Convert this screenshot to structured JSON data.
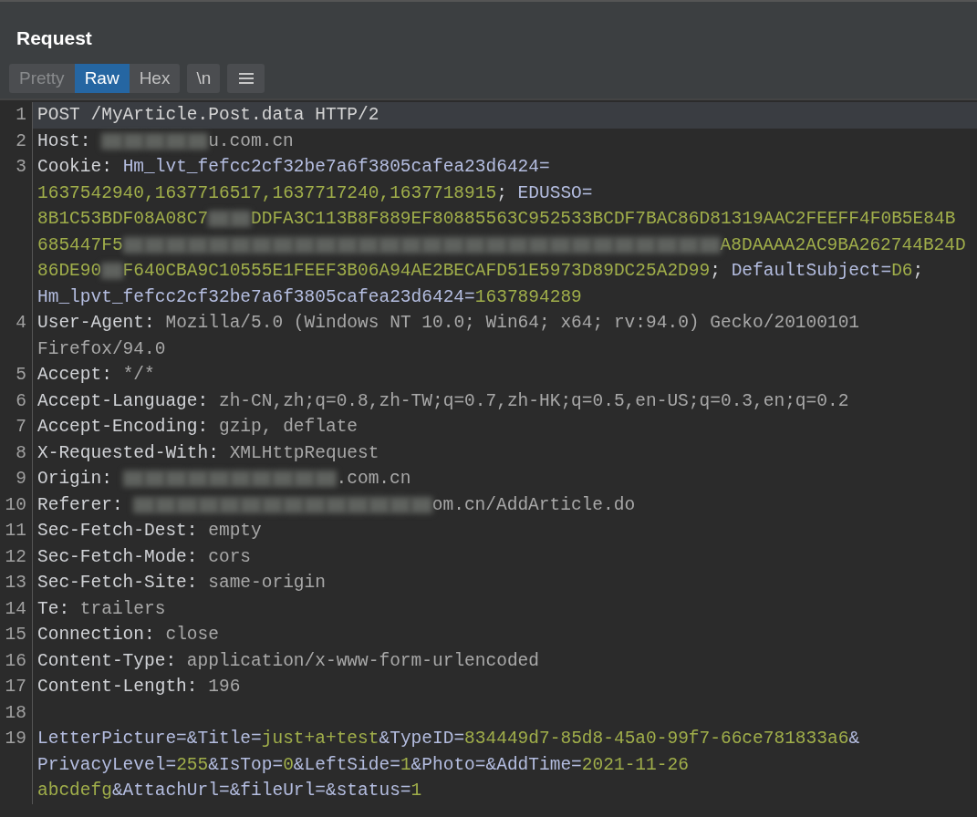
{
  "panel": {
    "title": "Request"
  },
  "tabs": [
    {
      "label": "Pretty",
      "selected": false,
      "disabled": true
    },
    {
      "label": "Raw",
      "selected": true,
      "disabled": false
    },
    {
      "label": "Hex",
      "selected": false,
      "disabled": false
    }
  ],
  "toggle_button": {
    "label": "\\n"
  },
  "editor": {
    "lines": [
      {
        "number": "1",
        "current": true,
        "rows": [
          {
            "segments": [
              {
                "kind": "plain",
                "text": "POST /MyArticle.Post.data HTTP/2"
              }
            ]
          }
        ]
      },
      {
        "number": "2",
        "current": false,
        "rows": [
          {
            "segments": [
              {
                "kind": "name",
                "text": "Host: "
              },
              {
                "kind": "redacted"
              },
              {
                "kind": "redacted"
              },
              {
                "kind": "redacted"
              },
              {
                "kind": "redacted"
              },
              {
                "kind": "redacted"
              },
              {
                "kind": "value",
                "text": "u.com.cn"
              }
            ]
          }
        ]
      },
      {
        "number": "3",
        "current": false,
        "rows": [
          {
            "segments": [
              {
                "kind": "name",
                "text": "Cookie: "
              },
              {
                "kind": "key",
                "text": "Hm_lvt_fefcc2cf32be7a6f3805cafea23d6424="
              }
            ]
          },
          {
            "segments": [
              {
                "kind": "val",
                "text": "1637542940,1637716517,1637717240,1637718915"
              },
              {
                "kind": "name",
                "text": "; "
              },
              {
                "kind": "key",
                "text": "EDUSSO="
              }
            ]
          },
          {
            "segments": [
              {
                "kind": "val",
                "text": "8B1C53BDF08A08C7"
              },
              {
                "kind": "redacted"
              },
              {
                "kind": "redacted"
              },
              {
                "kind": "val",
                "text": "DDFA3C113B8F889EF80885563C952533BCDF7BAC86D81319AAC2FEEFF4F0B5E84B"
              }
            ]
          },
          {
            "segments": [
              {
                "kind": "val",
                "text": "685447F5"
              },
              {
                "kind": "redacted"
              },
              {
                "kind": "redacted"
              },
              {
                "kind": "redacted"
              },
              {
                "kind": "redacted"
              },
              {
                "kind": "redacted"
              },
              {
                "kind": "redacted"
              },
              {
                "kind": "redacted"
              },
              {
                "kind": "redacted"
              },
              {
                "kind": "redacted"
              },
              {
                "kind": "redacted"
              },
              {
                "kind": "redacted"
              },
              {
                "kind": "redacted"
              },
              {
                "kind": "redacted"
              },
              {
                "kind": "redacted"
              },
              {
                "kind": "redacted"
              },
              {
                "kind": "redacted"
              },
              {
                "kind": "redacted"
              },
              {
                "kind": "redacted"
              },
              {
                "kind": "redacted"
              },
              {
                "kind": "redacted"
              },
              {
                "kind": "redacted"
              },
              {
                "kind": "redacted"
              },
              {
                "kind": "redacted"
              },
              {
                "kind": "redacted"
              },
              {
                "kind": "redacted"
              },
              {
                "kind": "redacted"
              },
              {
                "kind": "redacted"
              },
              {
                "kind": "redacted"
              },
              {
                "kind": "val",
                "text": "A8DAAAA2AC9BA262744B24D"
              }
            ]
          },
          {
            "segments": [
              {
                "kind": "val",
                "text": "86DE90"
              },
              {
                "kind": "redacted"
              },
              {
                "kind": "val",
                "text": "F640CBA9C10555E1FEEF3B06A94AE2BECAFD51E5973D89DC25A2D99"
              },
              {
                "kind": "name",
                "text": "; "
              },
              {
                "kind": "key",
                "text": "DefaultSubject="
              },
              {
                "kind": "val",
                "text": "D6"
              },
              {
                "kind": "name",
                "text": ";"
              }
            ]
          },
          {
            "segments": [
              {
                "kind": "key",
                "text": "Hm_lpvt_fefcc2cf32be7a6f3805cafea23d6424="
              },
              {
                "kind": "val",
                "text": "1637894289"
              }
            ]
          }
        ]
      },
      {
        "number": "4",
        "current": false,
        "rows": [
          {
            "segments": [
              {
                "kind": "name",
                "text": "User-Agent: "
              },
              {
                "kind": "value",
                "text": "Mozilla/5.0 (Windows NT 10.0; Win64; x64; rv:94.0) Gecko/20100101"
              }
            ]
          },
          {
            "segments": [
              {
                "kind": "value",
                "text": "Firefox/94.0"
              }
            ]
          }
        ]
      },
      {
        "number": "5",
        "current": false,
        "rows": [
          {
            "segments": [
              {
                "kind": "name",
                "text": "Accept: "
              },
              {
                "kind": "value",
                "text": "*/*"
              }
            ]
          }
        ]
      },
      {
        "number": "6",
        "current": false,
        "rows": [
          {
            "segments": [
              {
                "kind": "name",
                "text": "Accept-Language: "
              },
              {
                "kind": "value",
                "text": "zh-CN,zh;q=0.8,zh-TW;q=0.7,zh-HK;q=0.5,en-US;q=0.3,en;q=0.2"
              }
            ]
          }
        ]
      },
      {
        "number": "7",
        "current": false,
        "rows": [
          {
            "segments": [
              {
                "kind": "name",
                "text": "Accept-Encoding: "
              },
              {
                "kind": "value",
                "text": "gzip, deflate"
              }
            ]
          }
        ]
      },
      {
        "number": "8",
        "current": false,
        "rows": [
          {
            "segments": [
              {
                "kind": "name",
                "text": "X-Requested-With: "
              },
              {
                "kind": "value",
                "text": "XMLHttpRequest"
              }
            ]
          }
        ]
      },
      {
        "number": "9",
        "current": false,
        "rows": [
          {
            "segments": [
              {
                "kind": "name",
                "text": "Origin: "
              },
              {
                "kind": "redacted"
              },
              {
                "kind": "redacted"
              },
              {
                "kind": "redacted"
              },
              {
                "kind": "redacted"
              },
              {
                "kind": "redacted"
              },
              {
                "kind": "redacted"
              },
              {
                "kind": "redacted"
              },
              {
                "kind": "redacted"
              },
              {
                "kind": "redacted"
              },
              {
                "kind": "redacted"
              },
              {
                "kind": "value",
                "text": ".com.cn"
              }
            ]
          }
        ]
      },
      {
        "number": "10",
        "current": false,
        "rows": [
          {
            "segments": [
              {
                "kind": "name",
                "text": "Referer: "
              },
              {
                "kind": "redacted"
              },
              {
                "kind": "redacted"
              },
              {
                "kind": "redacted"
              },
              {
                "kind": "redacted"
              },
              {
                "kind": "redacted"
              },
              {
                "kind": "redacted"
              },
              {
                "kind": "redacted"
              },
              {
                "kind": "redacted"
              },
              {
                "kind": "redacted"
              },
              {
                "kind": "redacted"
              },
              {
                "kind": "redacted"
              },
              {
                "kind": "redacted"
              },
              {
                "kind": "redacted"
              },
              {
                "kind": "redacted"
              },
              {
                "kind": "value",
                "text": "om.cn/AddArticle.do"
              }
            ]
          }
        ]
      },
      {
        "number": "11",
        "current": false,
        "rows": [
          {
            "segments": [
              {
                "kind": "name",
                "text": "Sec-Fetch-Dest: "
              },
              {
                "kind": "value",
                "text": "empty"
              }
            ]
          }
        ]
      },
      {
        "number": "12",
        "current": false,
        "rows": [
          {
            "segments": [
              {
                "kind": "name",
                "text": "Sec-Fetch-Mode: "
              },
              {
                "kind": "value",
                "text": "cors"
              }
            ]
          }
        ]
      },
      {
        "number": "13",
        "current": false,
        "rows": [
          {
            "segments": [
              {
                "kind": "name",
                "text": "Sec-Fetch-Site: "
              },
              {
                "kind": "value",
                "text": "same-origin"
              }
            ]
          }
        ]
      },
      {
        "number": "14",
        "current": false,
        "rows": [
          {
            "segments": [
              {
                "kind": "name",
                "text": "Te: "
              },
              {
                "kind": "value",
                "text": "trailers"
              }
            ]
          }
        ]
      },
      {
        "number": "15",
        "current": false,
        "rows": [
          {
            "segments": [
              {
                "kind": "name",
                "text": "Connection: "
              },
              {
                "kind": "value",
                "text": "close"
              }
            ]
          }
        ]
      },
      {
        "number": "16",
        "current": false,
        "rows": [
          {
            "segments": [
              {
                "kind": "name",
                "text": "Content-Type: "
              },
              {
                "kind": "value",
                "text": "application/x-www-form-urlencoded"
              }
            ]
          }
        ]
      },
      {
        "number": "17",
        "current": false,
        "rows": [
          {
            "segments": [
              {
                "kind": "name",
                "text": "Content-Length: "
              },
              {
                "kind": "value",
                "text": "196"
              }
            ]
          }
        ]
      },
      {
        "number": "18",
        "current": false
      },
      {
        "number": "19",
        "current": false,
        "rows": [
          {
            "segments": [
              {
                "kind": "key",
                "text": "LetterPicture=&Title="
              },
              {
                "kind": "val",
                "text": "just+a+test"
              },
              {
                "kind": "key",
                "text": "&TypeID="
              },
              {
                "kind": "val",
                "text": "834449d7-85d8-45a0-99f7-66ce781833a6"
              },
              {
                "kind": "key",
                "text": "&"
              }
            ]
          },
          {
            "segments": [
              {
                "kind": "key",
                "text": "PrivacyLevel="
              },
              {
                "kind": "val",
                "text": "255"
              },
              {
                "kind": "key",
                "text": "&IsTop="
              },
              {
                "kind": "val",
                "text": "0"
              },
              {
                "kind": "key",
                "text": "&LeftSide="
              },
              {
                "kind": "val",
                "text": "1"
              },
              {
                "kind": "key",
                "text": "&Photo=&AddTime="
              },
              {
                "kind": "val",
                "text": "2021-11-26"
              }
            ]
          },
          {
            "segments": [
              {
                "kind": "val",
                "text": "abcdefg"
              },
              {
                "kind": "key",
                "text": "&AttachUrl=&fileUrl=&status="
              },
              {
                "kind": "val",
                "text": "1"
              }
            ]
          }
        ]
      }
    ]
  }
}
